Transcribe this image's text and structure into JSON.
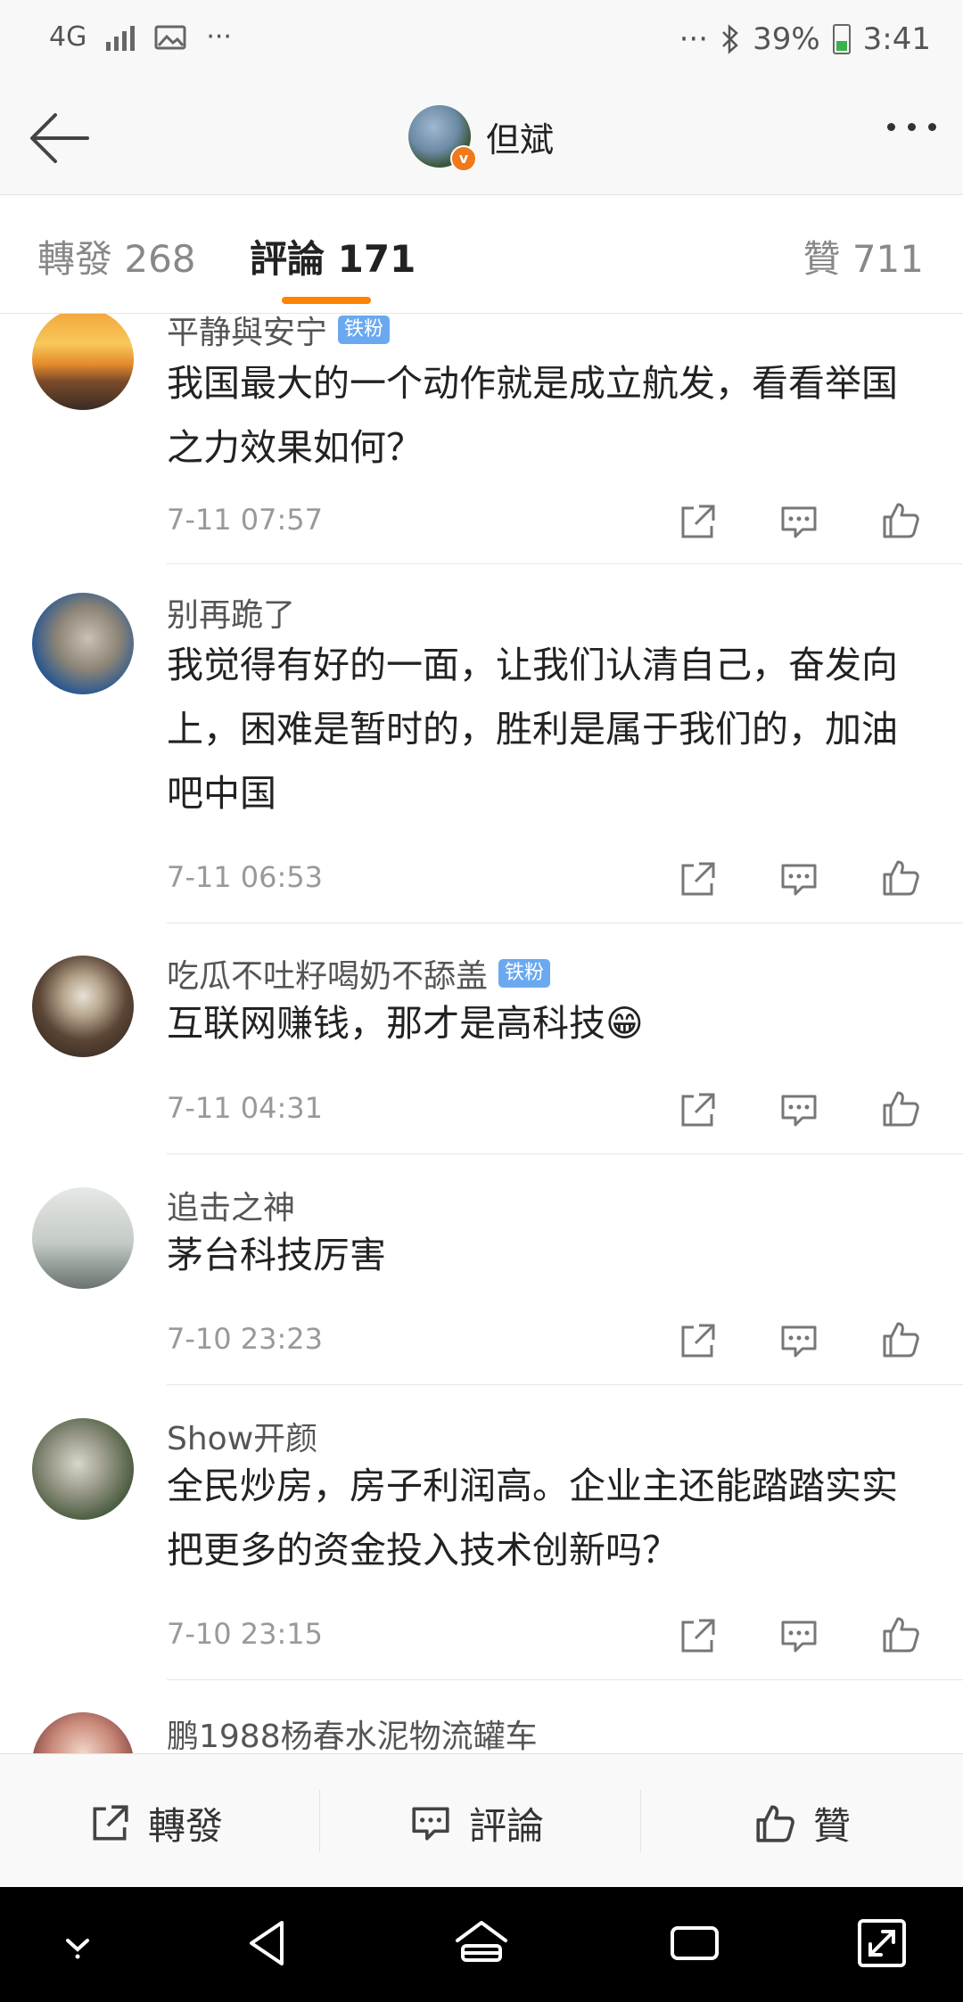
{
  "status_bar": {
    "network": "4G",
    "more": "···",
    "right_more": "···",
    "battery": "39%",
    "time": "3:41"
  },
  "header": {
    "back": "back-arrow",
    "name": "但斌",
    "more": "more"
  },
  "tabs": {
    "forward": "轉發 268",
    "comment": "評論 171",
    "like": "贊 711"
  },
  "comments": [
    {
      "user": "平静與安宁",
      "badge": "铁粉",
      "text": "我国最大的一个动作就是成立航发，看看举国之力效果如何？",
      "time": "7-11 07:57"
    },
    {
      "user": "别再跪了",
      "badge": "",
      "text": "我觉得有好的一面，让我们认清自己，奋发向上，困难是暂时的，胜利是属于我们的，加油吧中国",
      "time": "7-11 06:53"
    },
    {
      "user": "吃瓜不吐籽喝奶不舔盖",
      "badge": "铁粉",
      "text": "互联网赚钱，那才是高科技😁",
      "time": "7-11 04:31"
    },
    {
      "user": "追击之神",
      "badge": "",
      "text": "茅台科技厉害",
      "time": "7-10 23:23"
    },
    {
      "user": "Show开颜",
      "badge": "",
      "text": "全民炒房，房子利润高。企业主还能踏踏实实把更多的资金投入技术创新吗？",
      "time": "7-10 23:15"
    },
    {
      "user": "鹏1988杨春水泥物流罐车",
      "badge": "",
      "text": "",
      "time": ""
    }
  ],
  "action_bar": {
    "forward": "轉發",
    "comment": "評論",
    "like": "贊"
  },
  "colors": {
    "accent": "#ff8200",
    "fan_badge": "#6aa9f0",
    "verified": "#f07a1a"
  }
}
